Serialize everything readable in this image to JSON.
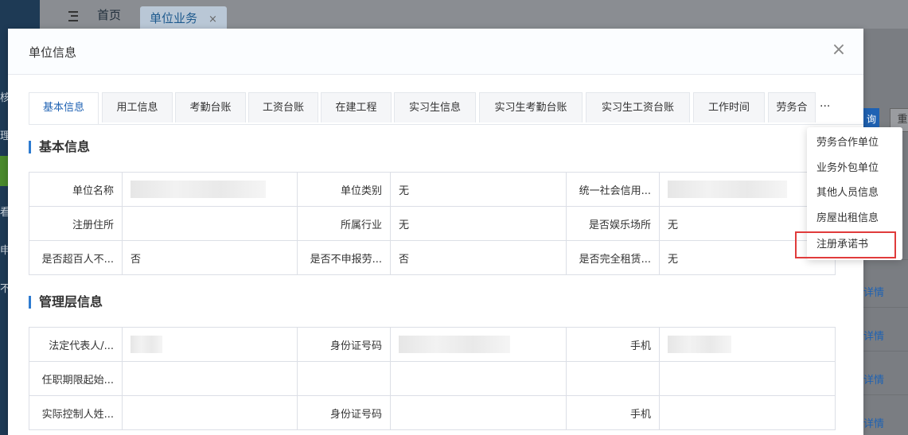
{
  "background": {
    "sidebar_fragments": [
      "核",
      "理",
      "看",
      "申",
      "不"
    ],
    "tabs": {
      "home": "首页",
      "unit": "单位业务",
      "close_glyph": "×"
    },
    "buttons": {
      "partial_a": "询",
      "partial_b": "重"
    },
    "detail_link": "详情"
  },
  "modal": {
    "title": "单位信息",
    "close_glyph": "×",
    "tabs": [
      "基本信息",
      "用工信息",
      "考勤台账",
      "工资台账",
      "在建工程",
      "实习生信息",
      "实习生考勤台账",
      "实习生工资台账",
      "工作时间",
      "劳务合"
    ],
    "more_glyph": "···",
    "basic": {
      "title": "基本信息",
      "rows": [
        [
          "单位名称",
          "",
          "单位类别",
          "无",
          "统一社会信用...",
          ""
        ],
        [
          "注册住所",
          "",
          "所属行业",
          "无",
          "是否娱乐场所",
          "无"
        ],
        [
          "是否超百人不...",
          "否",
          "是否不申报劳...",
          "否",
          "是否完全租赁...",
          "无"
        ]
      ]
    },
    "management": {
      "title": "管理层信息",
      "rows": [
        [
          "法定代表人/...",
          "",
          "身份证号码",
          "",
          "手机",
          ""
        ],
        [
          "任职期限起始...",
          "",
          "",
          "",
          "",
          ""
        ],
        [
          "实际控制人姓...",
          "",
          "身份证号码",
          "",
          "手机",
          ""
        ]
      ]
    }
  },
  "dropdown": {
    "items": [
      "劳务合作单位",
      "业务外包单位",
      "其他人员信息",
      "房屋出租信息",
      "注册承诺书"
    ]
  }
}
